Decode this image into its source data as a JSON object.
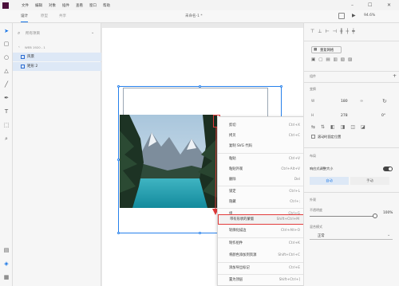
{
  "menubar": {
    "items": [
      "文件",
      "编辑",
      "对象",
      "插件",
      "查看",
      "窗口",
      "帮助"
    ],
    "window_controls": [
      "–",
      "☐",
      "✕"
    ]
  },
  "tabs": [
    {
      "label": "设计",
      "active": true
    },
    {
      "label": "原型",
      "active": false
    },
    {
      "label": "共享",
      "active": false
    }
  ],
  "document_title": "未命名-1 *",
  "zoom": "94.6%",
  "layers": {
    "search_placeholder": "所有项目",
    "artboard_label": "WEB 1920 - 1",
    "rows": [
      {
        "label": "风景"
      },
      {
        "label": "矩形 2"
      }
    ]
  },
  "properties": {
    "repeat_grid_label": "重复网格",
    "component_label": "组件",
    "transform_label": "变换",
    "w_label": "W",
    "w_value": "180",
    "h_label": "H",
    "h_value": "278",
    "x_value": "0°",
    "scroll_label": "滚动时固定位置",
    "layout_label": "布局",
    "responsive_label": "响应式调整大小",
    "auto_label": "自动",
    "manual_label": "手动",
    "appearance_label": "外观",
    "opacity_label": "不透明度",
    "opacity_value": "100%",
    "blend_label": "混合模式",
    "blend_value": "正常"
  },
  "context_menu": {
    "items": [
      {
        "label": "剪切",
        "shortcut": "Ctrl+X"
      },
      {
        "label": "拷贝",
        "shortcut": "Ctrl+C"
      },
      {
        "label": "复制 SVG 代码",
        "shortcut": ""
      },
      {
        "label": "粘贴",
        "shortcut": "Ctrl+V"
      },
      {
        "label": "粘贴外观",
        "shortcut": "Ctrl+Alt+V"
      },
      {
        "label": "删除",
        "shortcut": "Del"
      },
      {
        "label": "锁定",
        "shortcut": "Ctrl+L"
      },
      {
        "label": "隐藏",
        "shortcut": "Ctrl+;"
      },
      {
        "label": "组",
        "shortcut": "Ctrl+G"
      },
      {
        "label": "带有形状的蒙版",
        "shortcut": "Shift+Ctrl+M",
        "highlighted": true
      },
      {
        "label": "轮廓化描边",
        "shortcut": "Ctrl+Alt+O"
      },
      {
        "label": "制作组件",
        "shortcut": "Ctrl+K"
      },
      {
        "label": "将颜色添加到资源",
        "shortcut": "Shift+Ctrl+C"
      },
      {
        "label": "添加导出标记",
        "shortcut": "Ctrl+E"
      },
      {
        "label": "置为顶层",
        "shortcut": "Shift+Ctrl+]"
      }
    ]
  },
  "colors": {
    "accent": "#1473e6",
    "highlight_border": "#e23b3b",
    "arrow": "#e23b3b",
    "logo": "#4b0f3b"
  }
}
